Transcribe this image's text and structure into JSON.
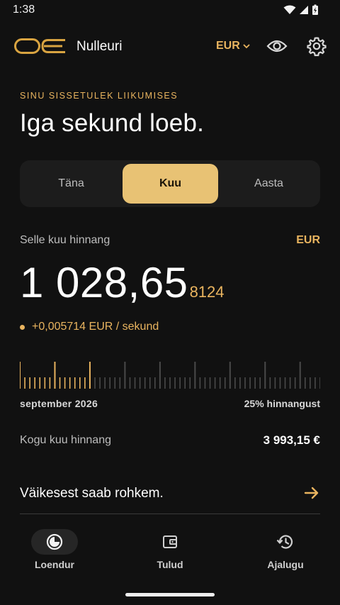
{
  "status": {
    "time": "1:38"
  },
  "app": {
    "name": "Nulleuri",
    "currency": "EUR"
  },
  "hero": {
    "eyebrow": "SINU SISSETULEK LIIKUMISES",
    "headline": "Iga sekund loeb."
  },
  "tabs": [
    {
      "label": "Täna",
      "active": false
    },
    {
      "label": "Kuu",
      "active": true
    },
    {
      "label": "Aasta",
      "active": false
    }
  ],
  "estimate": {
    "label": "Selle kuu hinnang",
    "currency": "EUR",
    "amount_main": "1 028,65",
    "amount_fraction": "8124",
    "rate": "+0,005714 EUR / sekund"
  },
  "progress": {
    "month": "september 2026",
    "percent_text": "25% hinnangust",
    "fraction": 0.25,
    "filled_color": "#e9b45f",
    "empty_color": "#4a4a4a"
  },
  "total": {
    "label": "Kogu kuu hinnang",
    "value": "3 993,15 €"
  },
  "promo": {
    "text": "Väikesest saab rohkem."
  },
  "nav": [
    {
      "label": "Loendur",
      "icon": "timer-icon",
      "active": true
    },
    {
      "label": "Tulud",
      "icon": "wallet-icon",
      "active": false
    },
    {
      "label": "Ajalugu",
      "icon": "history-icon",
      "active": false
    }
  ],
  "colors": {
    "accent": "#e9b45f",
    "background": "#111111",
    "active_tab": "#e8c274"
  }
}
